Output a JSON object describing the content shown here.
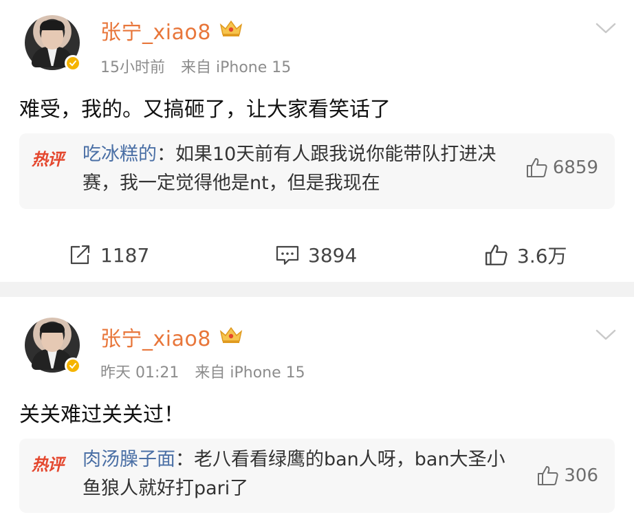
{
  "posts": [
    {
      "author": "张宁_xiao8",
      "time": "15小时前",
      "source": "来自 iPhone 15",
      "content": "难受，我的。又搞砸了，让大家看笑话了",
      "hot_comment": {
        "badge": "热评",
        "author": "吃冰糕的",
        "separator": "：",
        "text": "如果10天前有人跟我说你能带队打进决赛，我一定觉得他是nt，但是我现在",
        "likes": "6859"
      },
      "actions": {
        "repost": "1187",
        "comment": "3894",
        "like": "3.6万"
      }
    },
    {
      "author": "张宁_xiao8",
      "time": "昨天 01:21",
      "source": "来自 iPhone 15",
      "content": "关关难过关关过！",
      "hot_comment": {
        "badge": "热评",
        "author": "肉汤臊子面",
        "separator": "：",
        "text": "老八看看绿鹰的ban人呀，ban大圣小鱼狼人就好打pari了",
        "likes": "306"
      }
    }
  ],
  "colors": {
    "username": "#e8763a",
    "hot_badge": "#e4472e",
    "comment_author": "#4a6fa5",
    "meta": "#8c8c8c",
    "divider": "#f2f2f2"
  },
  "icons": [
    "crown-icon",
    "verified-icon",
    "chevron-down-icon",
    "repost-icon",
    "comment-icon",
    "like-icon"
  ]
}
